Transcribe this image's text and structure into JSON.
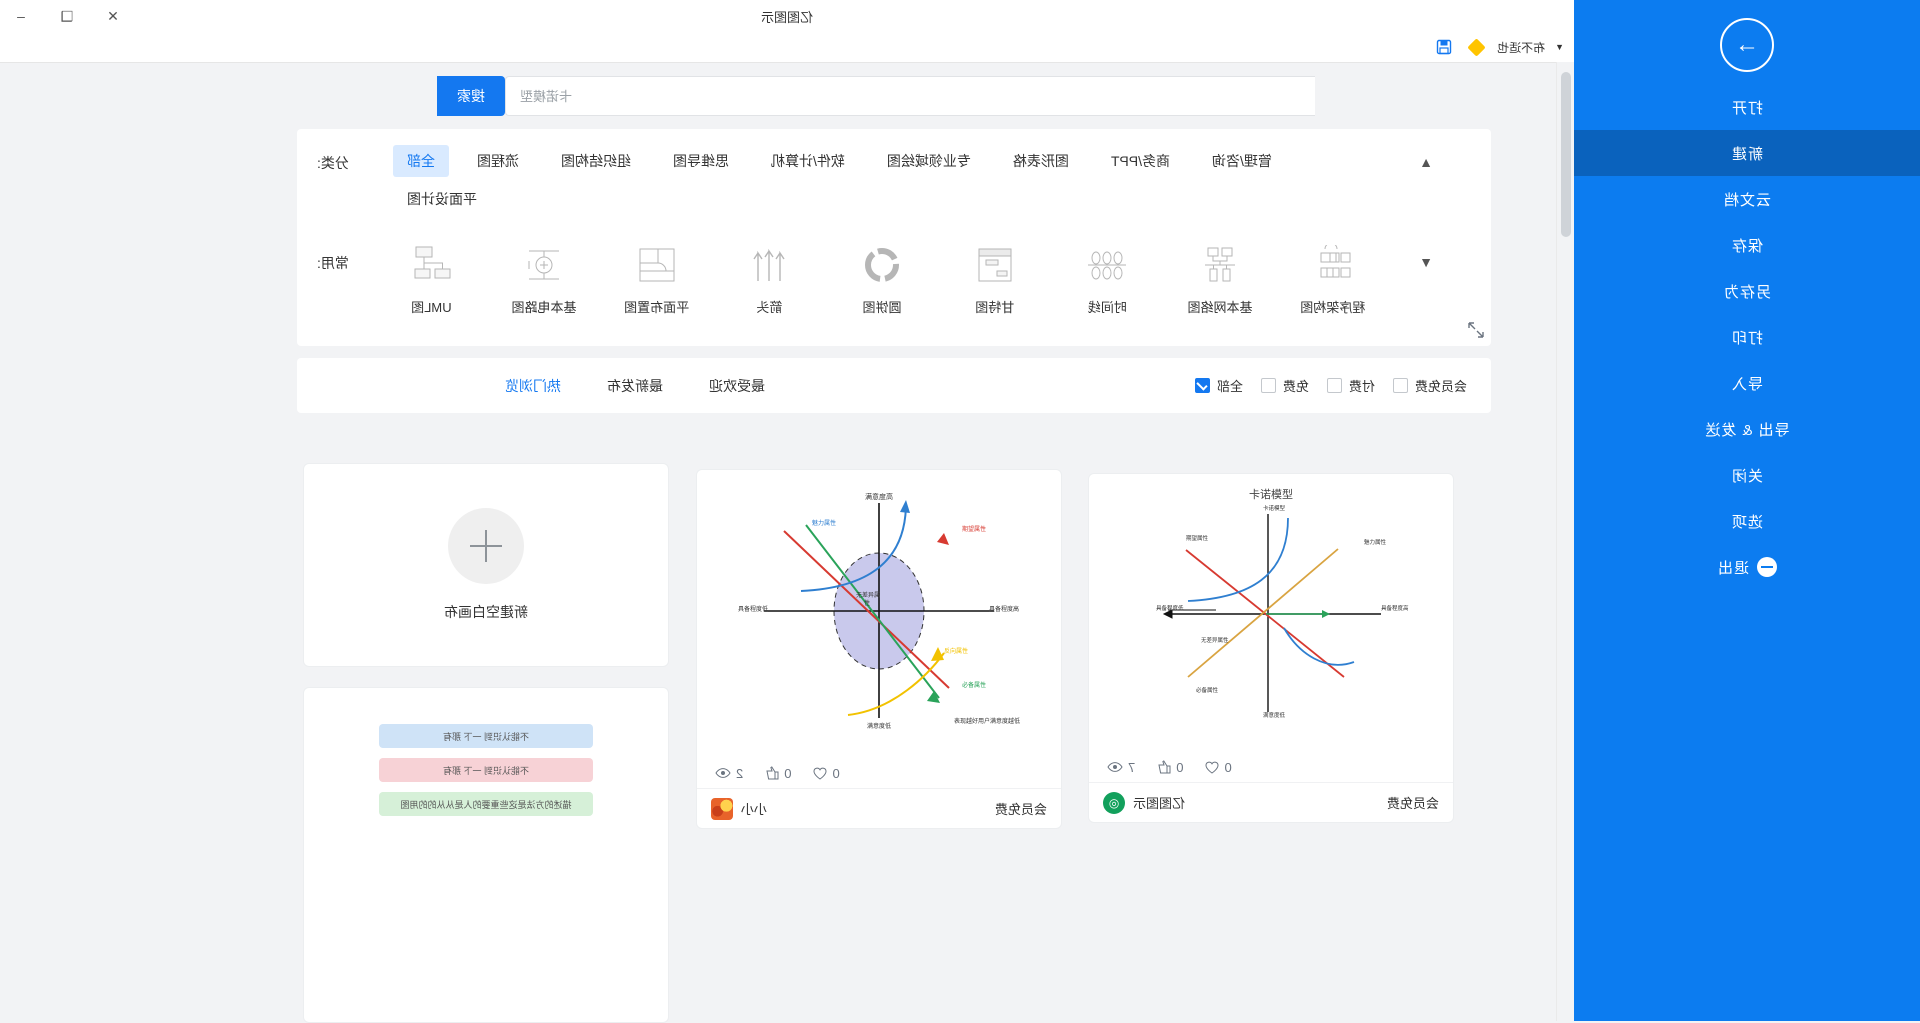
{
  "window": {
    "title": "亿图图示",
    "minimize_icon": "minimize-icon",
    "restore_icon": "restore-icon",
    "close_icon": "close-icon"
  },
  "quick_access": {
    "save_icon": "save-icon",
    "diamond_icon": "diamond-icon",
    "label": "布不适也",
    "caret_icon": "chevron-down-icon"
  },
  "backstage": {
    "arrow_icon": "arrow-right-icon",
    "items": [
      {
        "label": "打开",
        "active": false
      },
      {
        "label": "新建",
        "active": true
      },
      {
        "label": "云文档",
        "active": false
      },
      {
        "label": "保存",
        "active": false
      },
      {
        "label": "另存为",
        "active": false
      },
      {
        "label": "打印",
        "active": false
      },
      {
        "label": "导入",
        "active": false
      },
      {
        "label": "导出 & 发送",
        "active": false
      },
      {
        "label": "关闭",
        "active": false
      },
      {
        "label": "选项",
        "active": false
      },
      {
        "label": "退出",
        "active": false,
        "icon": "minus-circle-icon"
      }
    ]
  },
  "search": {
    "button_label": "搜索",
    "placeholder": "卡诺模型",
    "value": ""
  },
  "categories": {
    "label": "分类:",
    "collapse_icon": "chevron-up-icon",
    "items": [
      {
        "label": "全部",
        "selected": true
      },
      {
        "label": "流程图",
        "selected": false
      },
      {
        "label": "组织结构图",
        "selected": false
      },
      {
        "label": "思维导图",
        "selected": false
      },
      {
        "label": "软件/计算机",
        "selected": false
      },
      {
        "label": "专业领域绘图",
        "selected": false
      },
      {
        "label": "图形表格",
        "selected": false
      },
      {
        "label": "商务/PPT",
        "selected": false
      },
      {
        "label": "管理/咨询",
        "selected": false
      },
      {
        "label": "平面设计图",
        "selected": false
      }
    ]
  },
  "common": {
    "label": "常用:",
    "expand_icon": "chevron-down-icon",
    "items": [
      {
        "label": "UML图",
        "icon": "uml-diagram-icon"
      },
      {
        "label": "基本电路图",
        "icon": "circuit-diagram-icon"
      },
      {
        "label": "平面布置图",
        "icon": "floor-plan-icon"
      },
      {
        "label": "箭头",
        "icon": "arrows-icon"
      },
      {
        "label": "圆饼图",
        "icon": "pie-chart-icon"
      },
      {
        "label": "甘特图",
        "icon": "gantt-chart-icon"
      },
      {
        "label": "时间线",
        "icon": "timeline-icon"
      },
      {
        "label": "基本网络图",
        "icon": "network-diagram-icon"
      },
      {
        "label": "程序架构图",
        "icon": "program-architecture-icon"
      }
    ]
  },
  "expand_panel_icon": "expand-arrows-icon",
  "sort": {
    "items": [
      {
        "label": "热门浏览",
        "active": true
      },
      {
        "label": "最新发布",
        "active": false
      },
      {
        "label": "最受欢迎",
        "active": false
      }
    ]
  },
  "filters": [
    {
      "label": "全部",
      "checked": true
    },
    {
      "label": "免费",
      "checked": false
    },
    {
      "label": "付费",
      "checked": false
    },
    {
      "label": "会员免费",
      "checked": false
    }
  ],
  "cards": [
    {
      "name": "卡诺模型",
      "thumb_title": "卡诺模型",
      "views": "7",
      "views_icon": "eye-icon",
      "likes": "0",
      "likes_icon": "thumb-up-icon",
      "favorites": "0",
      "favorites_icon": "heart-icon",
      "footer_label": "亿图图示",
      "badge": "会员免费",
      "author_icon": "brand-badge-icon"
    },
    {
      "name": "卡诺模型",
      "thumb_title": "",
      "views": "2",
      "views_icon": "eye-icon",
      "likes": "0",
      "likes_icon": "thumb-up-icon",
      "favorites": "0",
      "favorites_icon": "heart-icon",
      "footer_label": "小小",
      "badge": "会员免费",
      "author_icon": "avatar-icon"
    }
  ],
  "new_canvas": {
    "label": "新建空白画布",
    "icon": "plus-icon"
  },
  "note_card": {
    "rows": [
      {
        "text": "不能认识到 一下 那有",
        "color": "#cfe3f7"
      },
      {
        "text": "不能认识到 一下 那有",
        "color": "#f7d2d6"
      },
      {
        "text": "描述的方法是这些重要的人是从从的的用图",
        "color": "#d6f0d8"
      }
    ]
  },
  "kano_chart": {
    "type": "scatter",
    "title": "卡诺模型",
    "axes": {
      "y_top": "满意度高",
      "y_bottom": "满意度低",
      "x_left": "具备程度低",
      "x_right": "具备程度高"
    },
    "series": [
      {
        "name": "魅力属性",
        "color": "#2f7fd0"
      },
      {
        "name": "期望属性",
        "color": "#d73a31"
      },
      {
        "name": "必备属性",
        "color": "#f2c200"
      },
      {
        "name": "无差异属性",
        "color": "#2aa35a"
      },
      {
        "name": "反向属性",
        "color": "#8c6a3f"
      }
    ]
  }
}
